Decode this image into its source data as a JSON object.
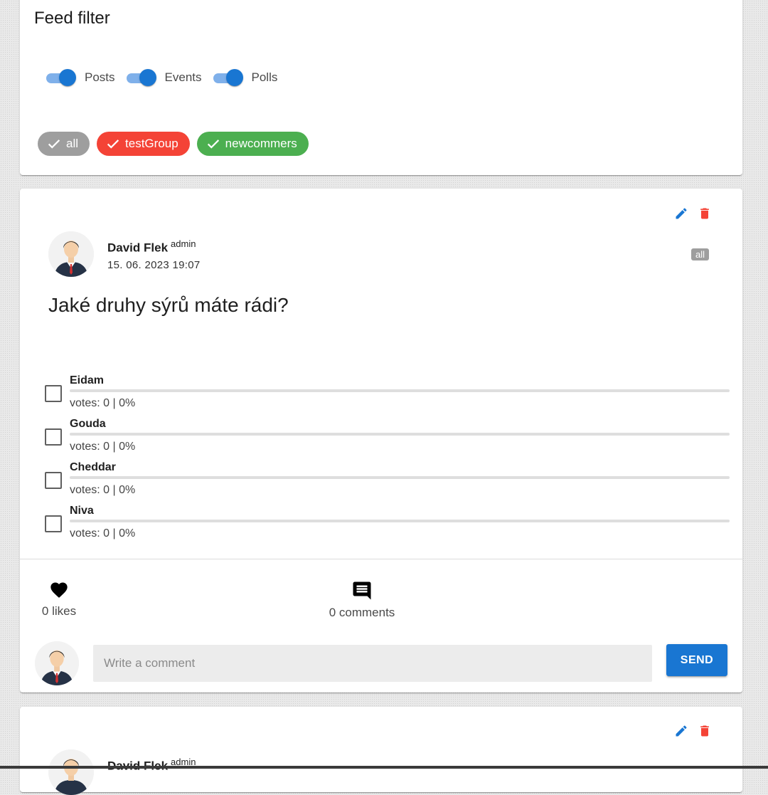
{
  "filter": {
    "title": "Feed filter",
    "toggles": [
      {
        "label": "Posts",
        "on": true
      },
      {
        "label": "Events",
        "on": true
      },
      {
        "label": "Polls",
        "on": true
      }
    ],
    "groups": [
      {
        "label": "all",
        "color": "#9e9e9e",
        "checked": true
      },
      {
        "label": "testGroup",
        "color": "#f44336",
        "checked": true
      },
      {
        "label": "newcommers",
        "color": "#4caf50",
        "checked": true
      }
    ]
  },
  "poll_post": {
    "author": "David Flek",
    "role": "admin",
    "date": "15. 06. 2023 19:07",
    "group": "all",
    "question": "Jaké druhy sýrů máte rádi?",
    "options": [
      {
        "name": "Eidam",
        "votes": "votes: 0 | 0%",
        "percent": 0
      },
      {
        "name": "Gouda",
        "votes": "votes: 0 | 0%",
        "percent": 0
      },
      {
        "name": "Cheddar",
        "votes": "votes: 0 | 0%",
        "percent": 0
      },
      {
        "name": "Niva",
        "votes": "votes: 0 | 0%",
        "percent": 0
      }
    ],
    "likes_label": "0 likes",
    "comments_label": "0 comments",
    "comment_placeholder": "Write a comment",
    "send_label": "SEND"
  },
  "next_post": {
    "author": "David Flek",
    "role": "admin"
  },
  "colors": {
    "primary": "#1976d2",
    "danger": "#f44336",
    "success": "#4caf50",
    "neutral": "#9e9e9e"
  },
  "icons": {
    "edit": "pencil-icon",
    "delete": "trash-icon",
    "like": "heart-icon",
    "comment": "comment-icon"
  }
}
